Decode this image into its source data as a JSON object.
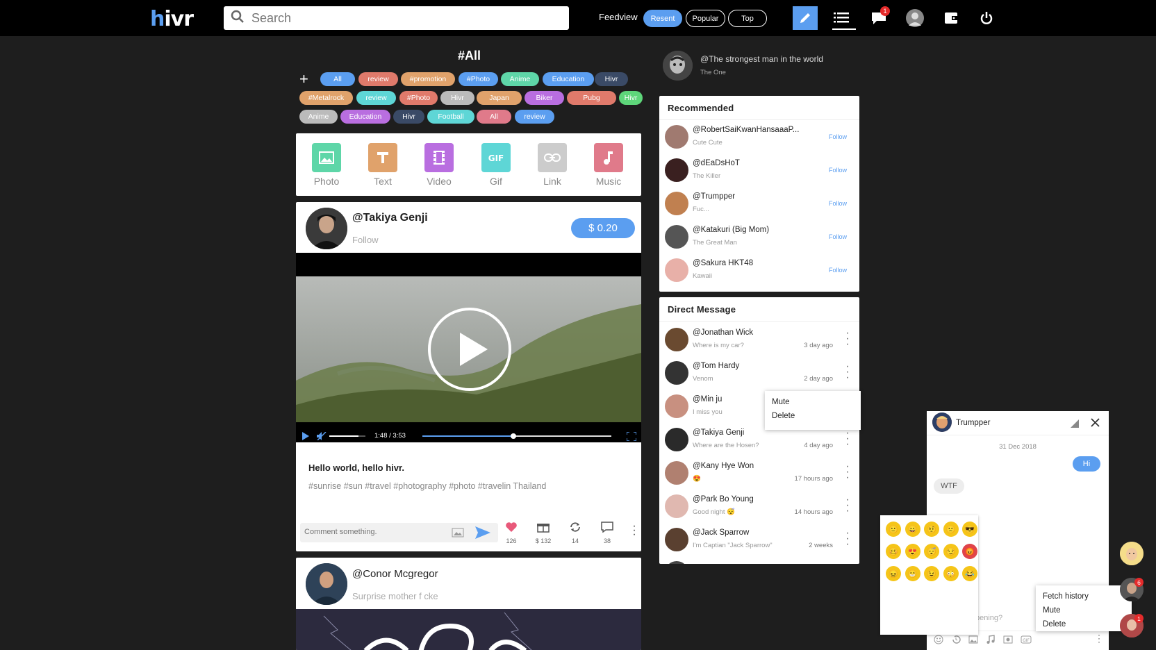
{
  "app": {
    "logo_prefix": "h",
    "logo_rest": "ivr"
  },
  "search": {
    "placeholder": "Search"
  },
  "feedview": {
    "label": "Feedview",
    "buttons": [
      "Resent",
      "Popular",
      "Top"
    ],
    "active": "Resent"
  },
  "header_icons": {
    "notification_count": "1"
  },
  "feed": {
    "title": "#All",
    "tags": [
      {
        "label": "All",
        "color": "#5b9ef0"
      },
      {
        "label": "review",
        "color": "#e07a6b"
      },
      {
        "label": "#promotion",
        "color": "#e0a26b"
      },
      {
        "label": "#Photo",
        "color": "#5b9ef0"
      },
      {
        "label": "Anime",
        "color": "#5ed6a8"
      },
      {
        "label": "Education",
        "color": "#5b9ef0"
      },
      {
        "label": "Hivr",
        "color": "#3a4a66"
      },
      {
        "label": "#Metalrock",
        "color": "#e0a26b"
      },
      {
        "label": "review",
        "color": "#5ed6d6"
      },
      {
        "label": "#Photo",
        "color": "#e07a6b"
      },
      {
        "label": "Hivr",
        "color": "#bbbbbb"
      },
      {
        "label": "Japan",
        "color": "#e0a26b"
      },
      {
        "label": "Biker",
        "color": "#b96ee0"
      },
      {
        "label": "Pubg",
        "color": "#e07a6b"
      },
      {
        "label": "Hivr",
        "color": "#5ed67a"
      },
      {
        "label": "Anime",
        "color": "#bbbbbb"
      },
      {
        "label": "Education",
        "color": "#b96ee0"
      },
      {
        "label": "Hivr",
        "color": "#3a4a66"
      },
      {
        "label": "Football",
        "color": "#5ed6d6"
      },
      {
        "label": "All",
        "color": "#e07a8a"
      },
      {
        "label": "review",
        "color": "#5b9ef0"
      }
    ],
    "post_types": [
      {
        "label": "Photo",
        "icon": "photo-icon",
        "color": "#5ed6a8"
      },
      {
        "label": "Text",
        "icon": "text-icon",
        "color": "#e0a26b"
      },
      {
        "label": "Video",
        "icon": "video-icon",
        "color": "#b96ee0"
      },
      {
        "label": "Gif",
        "icon": "gif-icon",
        "color": "#5ed6d6"
      },
      {
        "label": "Link",
        "icon": "link-icon",
        "color": "#cccccc"
      },
      {
        "label": "Music",
        "icon": "music-icon",
        "color": "#e07a8a"
      }
    ],
    "post1": {
      "author": "@Takiya Genji",
      "follow": "Follow",
      "price": "$ 0.20",
      "video_time": "1:48 / 3:53",
      "video_progress": 0.48,
      "volume_level": 0.8,
      "headline": "Hello world, hello hivr.",
      "hashtags": "#sunrise #sun #travel #photography #photo #travelin Thailand",
      "comment_placeholder": "Comment something.",
      "stats": {
        "likes": "126",
        "gifts": "$ 132",
        "reposts": "14",
        "comments": "38"
      }
    },
    "post2": {
      "author": "@Conor Mcgregor",
      "subtitle": "Surprise mother f cke"
    }
  },
  "profile": {
    "name": "@The strongest man in the world",
    "subtitle": "The One"
  },
  "recommended": {
    "title": "Recommended",
    "items": [
      {
        "name": "@RobertSaiKwanHansaaaP...",
        "sub": "Cute Cute",
        "action": "Follow",
        "color": "#a07a70"
      },
      {
        "name": "@dEaDsHoT",
        "sub": "The Killer",
        "action": "Follow",
        "color": "#3a2020"
      },
      {
        "name": "@Trumpper",
        "sub": "Fuc...",
        "action": "Follow",
        "color": "#c08050"
      },
      {
        "name": "@Katakuri (Big Mom)",
        "sub": "The Great Man",
        "action": "Follow",
        "color": "#555555"
      },
      {
        "name": "@Sakura HKT48",
        "sub": "Kawaii",
        "action": "Follow",
        "color": "#e8b0a8"
      }
    ]
  },
  "direct_message": {
    "title": "Direct Message",
    "items": [
      {
        "name": "@Jonathan Wick",
        "msg": "Where is my car?",
        "time": "3 day ago",
        "color": "#6a4a30"
      },
      {
        "name": "@Tom Hardy",
        "msg": "Venom",
        "time": "2 day ago",
        "color": "#333333"
      },
      {
        "name": "@Min ju",
        "msg": "I miss you",
        "time": "",
        "color": "#c89080"
      },
      {
        "name": "@Takiya Genji",
        "msg": "Where are the Hosen?",
        "time": "4 day ago",
        "color": "#2a2a2a"
      },
      {
        "name": "@Kany Hye Won",
        "msg": "😍",
        "time": "17 hours ago",
        "color": "#b08070"
      },
      {
        "name": "@Park Bo Young",
        "msg": "Good night 😴",
        "time": "14 hours ago",
        "color": "#e0b8b0"
      },
      {
        "name": "@Jack Sparrow",
        "msg": "I'm Captian \"Jack Sparrow\"",
        "time": "2 weeks",
        "color": "#5a4030"
      }
    ],
    "menu": [
      "Mute",
      "Delete"
    ]
  },
  "chat": {
    "name": "Trumpper",
    "date": "31 Dec 2018",
    "messages": [
      {
        "text": "Hi",
        "from": "me"
      },
      {
        "text": "WTF",
        "from": "them"
      }
    ],
    "input_placeholder": "pening?",
    "menu": [
      "Fetch history",
      "Mute",
      "Delete"
    ]
  },
  "emoji_picker": [
    "🙂",
    "😀",
    "🤨",
    "🙁",
    "😎",
    "🥴",
    "😍",
    "😴",
    "😏",
    "😡",
    "😖",
    "😁",
    "😉",
    "😳",
    "😂"
  ],
  "chat_heads": {
    "badge1": "6",
    "badge2": "1"
  }
}
